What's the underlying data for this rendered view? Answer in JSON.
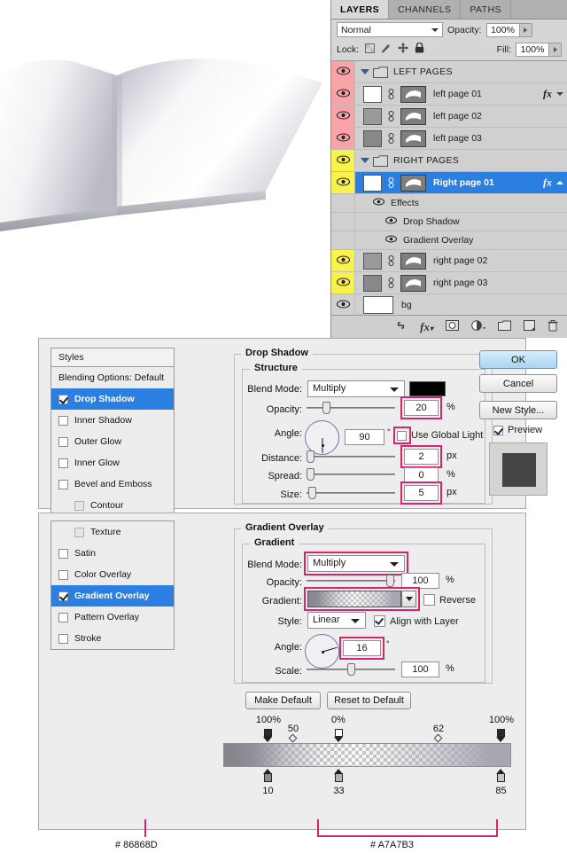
{
  "layers_panel": {
    "tabs": [
      {
        "label": "LAYERS",
        "active": true
      },
      {
        "label": "CHANNELS",
        "active": false
      },
      {
        "label": "PATHS",
        "active": false
      }
    ],
    "blend_mode": "Normal",
    "opacity_label": "Opacity:",
    "opacity_value": "100%",
    "lock_label": "Lock:",
    "fill_label": "Fill:",
    "fill_value": "100%",
    "rows": [
      {
        "kind": "group",
        "name": "LEFT PAGES",
        "eye_highlight": "pink"
      },
      {
        "kind": "layer",
        "name": "left page 01",
        "eye_highlight": "pink",
        "thumb": "white",
        "fx": "fx"
      },
      {
        "kind": "layer",
        "name": "left page 02",
        "eye_highlight": "pink",
        "thumb": "gray"
      },
      {
        "kind": "layer",
        "name": "left page 03",
        "eye_highlight": "pink",
        "thumb": "gray2"
      },
      {
        "kind": "group",
        "name": "RIGHT PAGES",
        "eye_highlight": "yellow"
      },
      {
        "kind": "layer",
        "name": "Right page 01",
        "eye_highlight": "yellow",
        "thumb": "white",
        "selected": true,
        "fx": "fx"
      },
      {
        "kind": "effects",
        "name": "Effects"
      },
      {
        "kind": "effect",
        "name": "Drop Shadow"
      },
      {
        "kind": "effect",
        "name": "Gradient Overlay"
      },
      {
        "kind": "layer",
        "name": "right page 02",
        "eye_highlight": "yellow",
        "thumb": "gray"
      },
      {
        "kind": "layer",
        "name": "right page 03",
        "eye_highlight": "yellow",
        "thumb": "gray2"
      },
      {
        "kind": "layer",
        "name": "bg",
        "eye_highlight": "none",
        "thumb": "bg"
      }
    ],
    "footer_icons": [
      "link-icon",
      "fx-icon",
      "mask-icon",
      "adjustment-icon",
      "group-icon",
      "new-layer-icon",
      "delete-icon"
    ]
  },
  "dialog": {
    "styles_header": "Styles",
    "styles_top": [
      {
        "label": "Blending Options: Default",
        "checkbox": "none",
        "selected": false
      },
      {
        "label": "Drop Shadow",
        "checkbox": "checked",
        "selected": true
      },
      {
        "label": "Inner Shadow",
        "checkbox": "unchecked",
        "selected": false
      },
      {
        "label": "Outer Glow",
        "checkbox": "unchecked",
        "selected": false
      },
      {
        "label": "Inner Glow",
        "checkbox": "unchecked",
        "selected": false
      },
      {
        "label": "Bevel and Emboss",
        "checkbox": "unchecked",
        "selected": false
      },
      {
        "label": "Contour",
        "checkbox": "dim",
        "selected": false,
        "indent": true
      }
    ],
    "styles_bottom": [
      {
        "label": "Texture",
        "checkbox": "dim",
        "selected": false,
        "indent": true
      },
      {
        "label": "Satin",
        "checkbox": "unchecked",
        "selected": false
      },
      {
        "label": "Color Overlay",
        "checkbox": "unchecked",
        "selected": false
      },
      {
        "label": "Gradient Overlay",
        "checkbox": "checked",
        "selected": true
      },
      {
        "label": "Pattern Overlay",
        "checkbox": "unchecked",
        "selected": false
      },
      {
        "label": "Stroke",
        "checkbox": "unchecked",
        "selected": false
      }
    ],
    "drop_shadow": {
      "title": "Drop Shadow",
      "structure_title": "Structure",
      "blend_mode_label": "Blend Mode:",
      "blend_mode_value": "Multiply",
      "color_swatch": "#000000",
      "opacity_label": "Opacity:",
      "opacity_value": "20",
      "opacity_unit": "%",
      "angle_label": "Angle:",
      "angle_value": "90",
      "angle_unit": "°",
      "global_light_label": "Use Global Light",
      "global_light_checked": false,
      "distance_label": "Distance:",
      "distance_value": "2",
      "distance_unit": "px",
      "spread_label": "Spread:",
      "spread_value": "0",
      "spread_unit": "%",
      "size_label": "Size:",
      "size_value": "5",
      "size_unit": "px"
    },
    "gradient_overlay": {
      "title": "Gradient Overlay",
      "gradient_title": "Gradient",
      "blend_mode_label": "Blend Mode:",
      "blend_mode_value": "Multiply",
      "opacity_label": "Opacity:",
      "opacity_value": "100",
      "opacity_unit": "%",
      "gradient_label": "Gradient:",
      "reverse_label": "Reverse",
      "reverse_checked": false,
      "style_label": "Style:",
      "style_value": "Linear",
      "align_label": "Align with Layer",
      "align_checked": true,
      "angle_label": "Angle:",
      "angle_value": "16",
      "angle_unit": "°",
      "scale_label": "Scale:",
      "scale_value": "100",
      "scale_unit": "%",
      "make_default": "Make Default",
      "reset_default": "Reset to Default"
    },
    "buttons": {
      "ok": "OK",
      "cancel": "Cancel",
      "new_style": "New Style...",
      "preview_label": "Preview",
      "preview_checked": true
    }
  },
  "gradient_editor": {
    "opacity_stops": [
      {
        "label": "100%",
        "pos_pct": 6,
        "fill": "#2a2a2a"
      },
      {
        "label": "0%",
        "pos_pct": 34,
        "fill": "#ffffff"
      },
      {
        "label": "100%",
        "pos_pct": 96,
        "fill": "#2a2a2a"
      }
    ],
    "opacity_midpoints": [
      {
        "label": "50",
        "pos_pct": 19
      },
      {
        "label": "62",
        "pos_pct": 71
      }
    ],
    "color_stops": [
      {
        "label": "10",
        "pos_pct": 6,
        "fill": "#8a8a92"
      },
      {
        "label": "33",
        "pos_pct": 34,
        "fill": "#b0b0b8"
      },
      {
        "label": "85",
        "pos_pct": 96,
        "fill": "#c6c6cc"
      }
    ],
    "annotations": [
      {
        "text": "# 86868D"
      },
      {
        "text": "# A7A7B3"
      }
    ]
  }
}
